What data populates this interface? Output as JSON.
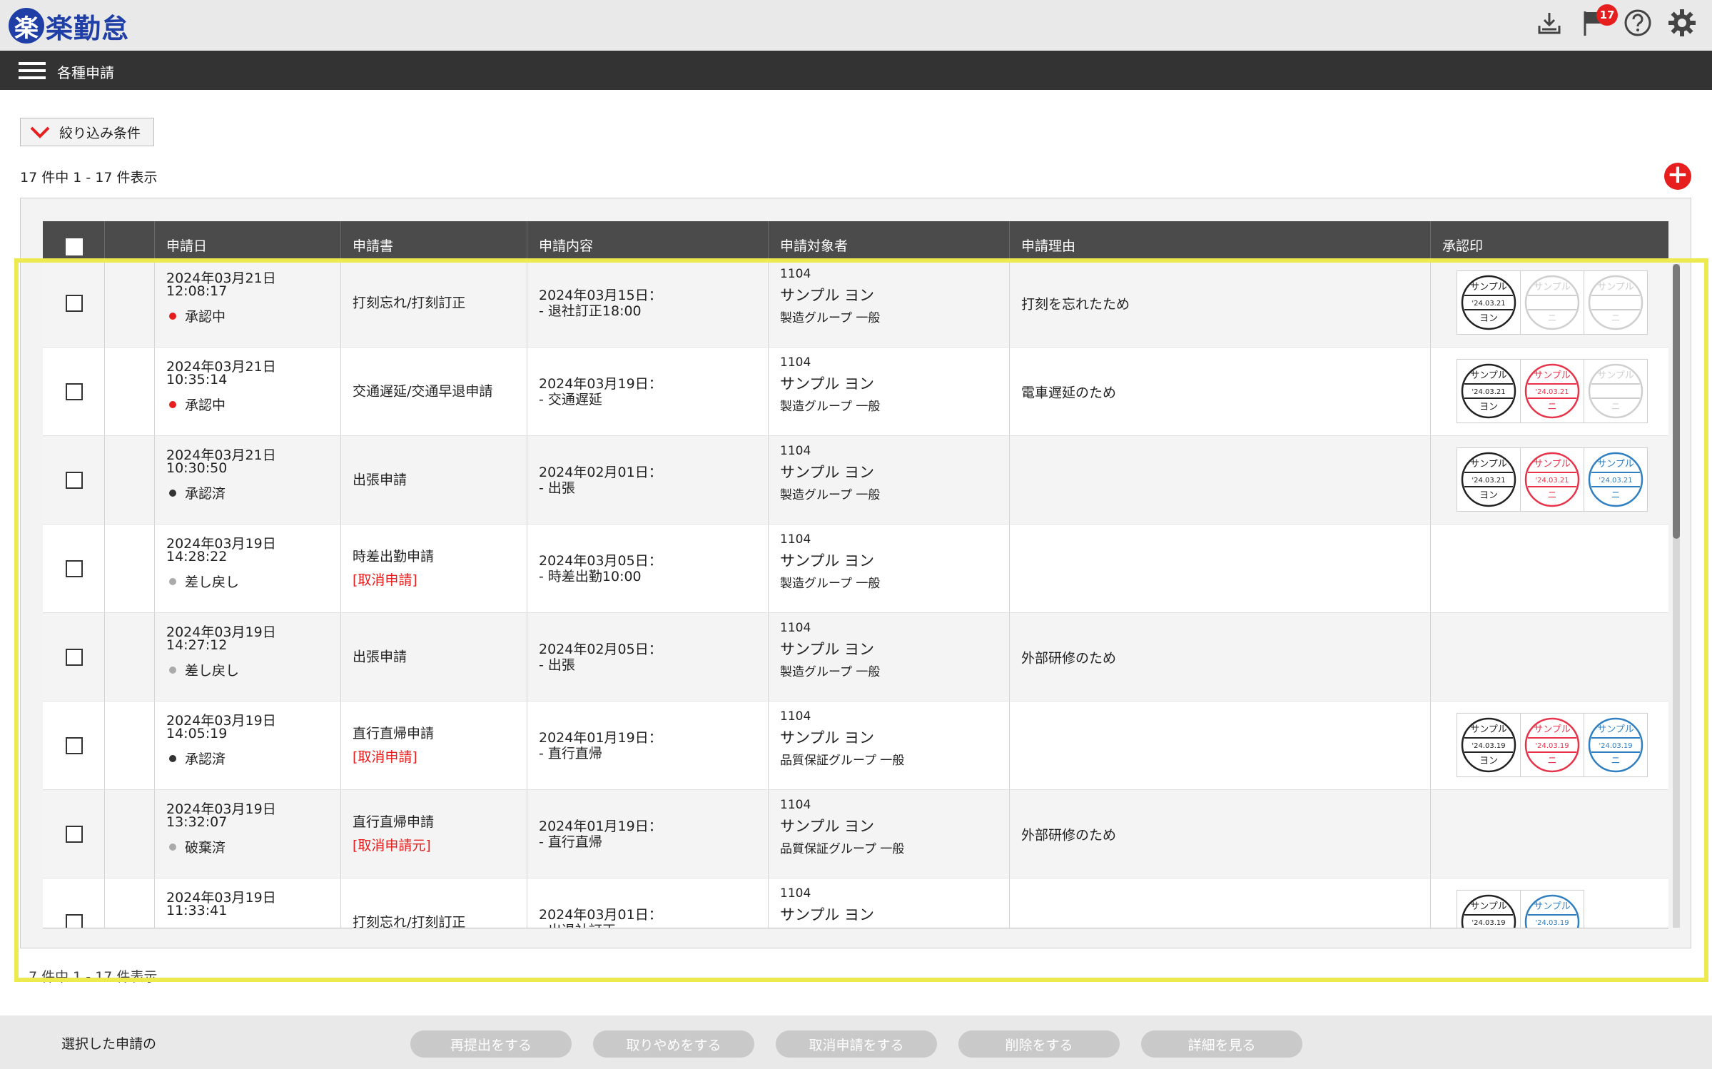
{
  "app": {
    "logo_mark": "楽",
    "logo_text": "楽勤怠"
  },
  "header": {
    "notification_count": "17"
  },
  "nav": {
    "title": "各種申請"
  },
  "filter": {
    "label": "絞り込み条件"
  },
  "list": {
    "count_text": "17 件中 1 - 17 件表示",
    "bottom_count_peek": "7 件中 1 - 17 件表示"
  },
  "table": {
    "columns": [
      "",
      "",
      "申請日",
      "申請書",
      "申請内容",
      "申請対象者",
      "申請理由",
      "承認印"
    ],
    "rows": [
      {
        "date": "2024年03月21日",
        "time": "12:08:17",
        "status": "承認中",
        "status_color": "#e61e1e",
        "form": "打刻忘れ/打刻訂正",
        "form_note": "",
        "content_date": "2024年03月15日：",
        "content_detail": "- 退社訂正18:00",
        "target_code": "1104",
        "target_name": "サンプル ヨン",
        "target_group": "製造グループ 一般",
        "reason": "打刻を忘れたため",
        "stamps": [
          {
            "top": "サンプル",
            "date": "'24.03.21",
            "bottom": "ヨン",
            "color": "#222"
          },
          {
            "top": "サンプル",
            "date": "",
            "bottom": "ニ",
            "color": "#cfcfcf"
          },
          {
            "top": "サンプル",
            "date": "",
            "bottom": "ニ",
            "color": "#cfcfcf"
          }
        ]
      },
      {
        "date": "2024年03月21日",
        "time": "10:35:14",
        "status": "承認中",
        "status_color": "#e61e1e",
        "form": "交通遅延/交通早退申請",
        "form_note": "",
        "content_date": "2024年03月19日：",
        "content_detail": "- 交通遅延",
        "target_code": "1104",
        "target_name": "サンプル ヨン",
        "target_group": "製造グループ 一般",
        "reason": "電車遅延のため",
        "stamps": [
          {
            "top": "サンプル",
            "date": "'24.03.21",
            "bottom": "ヨン",
            "color": "#222"
          },
          {
            "top": "サンプル",
            "date": "'24.03.21",
            "bottom": "ニ",
            "color": "#e8344a"
          },
          {
            "top": "サンプル",
            "date": "",
            "bottom": "ニ",
            "color": "#cfcfcf"
          }
        ]
      },
      {
        "date": "2024年03月21日",
        "time": "10:30:50",
        "status": "承認済",
        "status_color": "#333333",
        "form": "出張申請",
        "form_note": "",
        "content_date": "2024年02月01日：",
        "content_detail": "- 出張",
        "target_code": "1104",
        "target_name": "サンプル ヨン",
        "target_group": "製造グループ 一般",
        "reason": "",
        "stamps": [
          {
            "top": "サンプル",
            "date": "'24.03.21",
            "bottom": "ヨン",
            "color": "#222"
          },
          {
            "top": "サンプル",
            "date": "'24.03.21",
            "bottom": "ニ",
            "color": "#e8344a"
          },
          {
            "top": "サンプル",
            "date": "'24.03.21",
            "bottom": "ニ",
            "color": "#2f7fc1"
          }
        ]
      },
      {
        "date": "2024年03月19日",
        "time": "14:28:22",
        "status": "差し戻し",
        "status_color": "#aaaaaa",
        "form": "時差出勤申請",
        "form_note": "[取消申請]",
        "content_date": "2024年03月05日：",
        "content_detail": "- 時差出勤10:00",
        "target_code": "1104",
        "target_name": "サンプル ヨン",
        "target_group": "製造グループ 一般",
        "reason": "",
        "stamps": []
      },
      {
        "date": "2024年03月19日",
        "time": "14:27:12",
        "status": "差し戻し",
        "status_color": "#aaaaaa",
        "form": "出張申請",
        "form_note": "",
        "content_date": "2024年02月05日：",
        "content_detail": "- 出張",
        "target_code": "1104",
        "target_name": "サンプル ヨン",
        "target_group": "製造グループ 一般",
        "reason": "外部研修のため",
        "stamps": []
      },
      {
        "date": "2024年03月19日",
        "time": "14:05:19",
        "status": "承認済",
        "status_color": "#333333",
        "form": "直行直帰申請",
        "form_note": "[取消申請]",
        "content_date": "2024年01月19日：",
        "content_detail": "- 直行直帰",
        "target_code": "1104",
        "target_name": "サンプル ヨン",
        "target_group": "品質保証グループ 一般",
        "reason": "",
        "stamps": [
          {
            "top": "サンプル",
            "date": "'24.03.19",
            "bottom": "ヨン",
            "color": "#222"
          },
          {
            "top": "サンプル",
            "date": "'24.03.19",
            "bottom": "ニ",
            "color": "#e8344a"
          },
          {
            "top": "サンプル",
            "date": "'24.03.19",
            "bottom": "ニ",
            "color": "#2f7fc1"
          }
        ]
      },
      {
        "date": "2024年03月19日",
        "time": "13:32:07",
        "status": "破棄済",
        "status_color": "#aaaaaa",
        "form": "直行直帰申請",
        "form_note": "[取消申請元]",
        "content_date": "2024年01月19日：",
        "content_detail": "- 直行直帰",
        "target_code": "1104",
        "target_name": "サンプル ヨン",
        "target_group": "品質保証グループ 一般",
        "reason": "外部研修のため",
        "stamps": []
      },
      {
        "date": "2024年03月19日",
        "time": "11:33:41",
        "status": "",
        "status_color": "#333333",
        "form": "打刻忘れ/打刻訂正",
        "form_note": "",
        "content_date": "2024年03月01日：",
        "content_detail": "- 出退社訂正",
        "target_code": "1104",
        "target_name": "サンプル ヨン",
        "target_group": "",
        "reason": "",
        "stamps": [
          {
            "top": "サンプル",
            "date": "'24.03.19",
            "bottom": "ヨン",
            "color": "#222"
          },
          {
            "top": "サンプル",
            "date": "'24.03.19",
            "bottom": "ニ",
            "color": "#2f7fc1"
          }
        ]
      }
    ]
  },
  "footer": {
    "label": "選択した申請の",
    "buttons": [
      "再提出をする",
      "取りやめをする",
      "取消申請をする",
      "削除をする",
      "詳細を見る"
    ]
  },
  "colors": {
    "brand": "#1f3fa6",
    "accent_red": "#e61e1e",
    "highlight": "#ecea4f",
    "nav_bg": "#333333"
  }
}
